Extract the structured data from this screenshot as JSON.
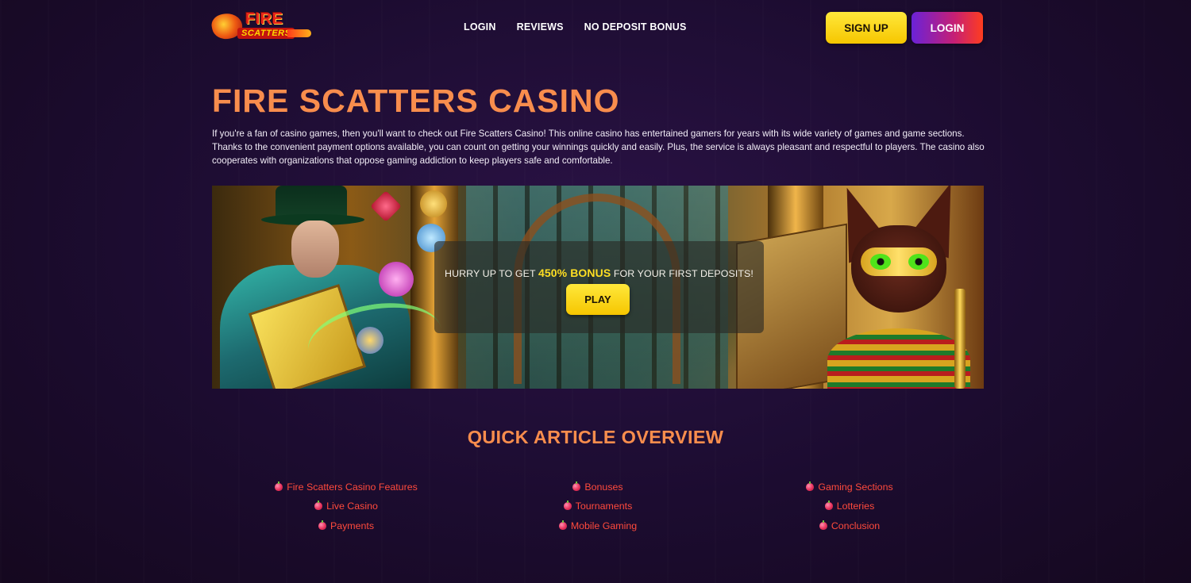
{
  "header": {
    "logo": {
      "line1": "FIRE",
      "line2": "SCATTERS"
    },
    "nav": [
      "LOGIN",
      "REVIEWS",
      "NO DEPOSIT BONUS"
    ],
    "signup_label": "SIGN UP",
    "login_label": "LOGIN"
  },
  "hero": {
    "title": "FIRE SCATTERS CASINO",
    "intro": "If you're a fan of casino games, then you'll want to check out Fire Scatters Casino! This online casino has entertained gamers for years with its wide variety of games and game sections. Thanks to the convenient payment options available, you can count on getting your winnings quickly and easily. Plus, the service is always pleasant and respectful to players. The casino also cooperates with organizations that oppose gaming addiction to keep players safe and comfortable."
  },
  "banner": {
    "promo_prefix": "HURRY UP TO GET ",
    "promo_highlight": "450% BONUS",
    "promo_suffix": " FOR YOUR FIRST DEPOSITS!",
    "play_label": "PLAY"
  },
  "overview": {
    "title": "QUICK ARTICLE OVERVIEW",
    "columns": [
      [
        "Fire Scatters Casino Features",
        "Live Casino",
        "Payments"
      ],
      [
        "Bonuses",
        "Tournaments",
        "Mobile Gaming"
      ],
      [
        "Gaming Sections",
        "Lotteries",
        "Conclusion"
      ]
    ]
  },
  "colors": {
    "title_orange": "#f88d4d",
    "link_red": "#ff4a3c",
    "button_yellow": "#f6c600",
    "background": "#1c0c30"
  }
}
